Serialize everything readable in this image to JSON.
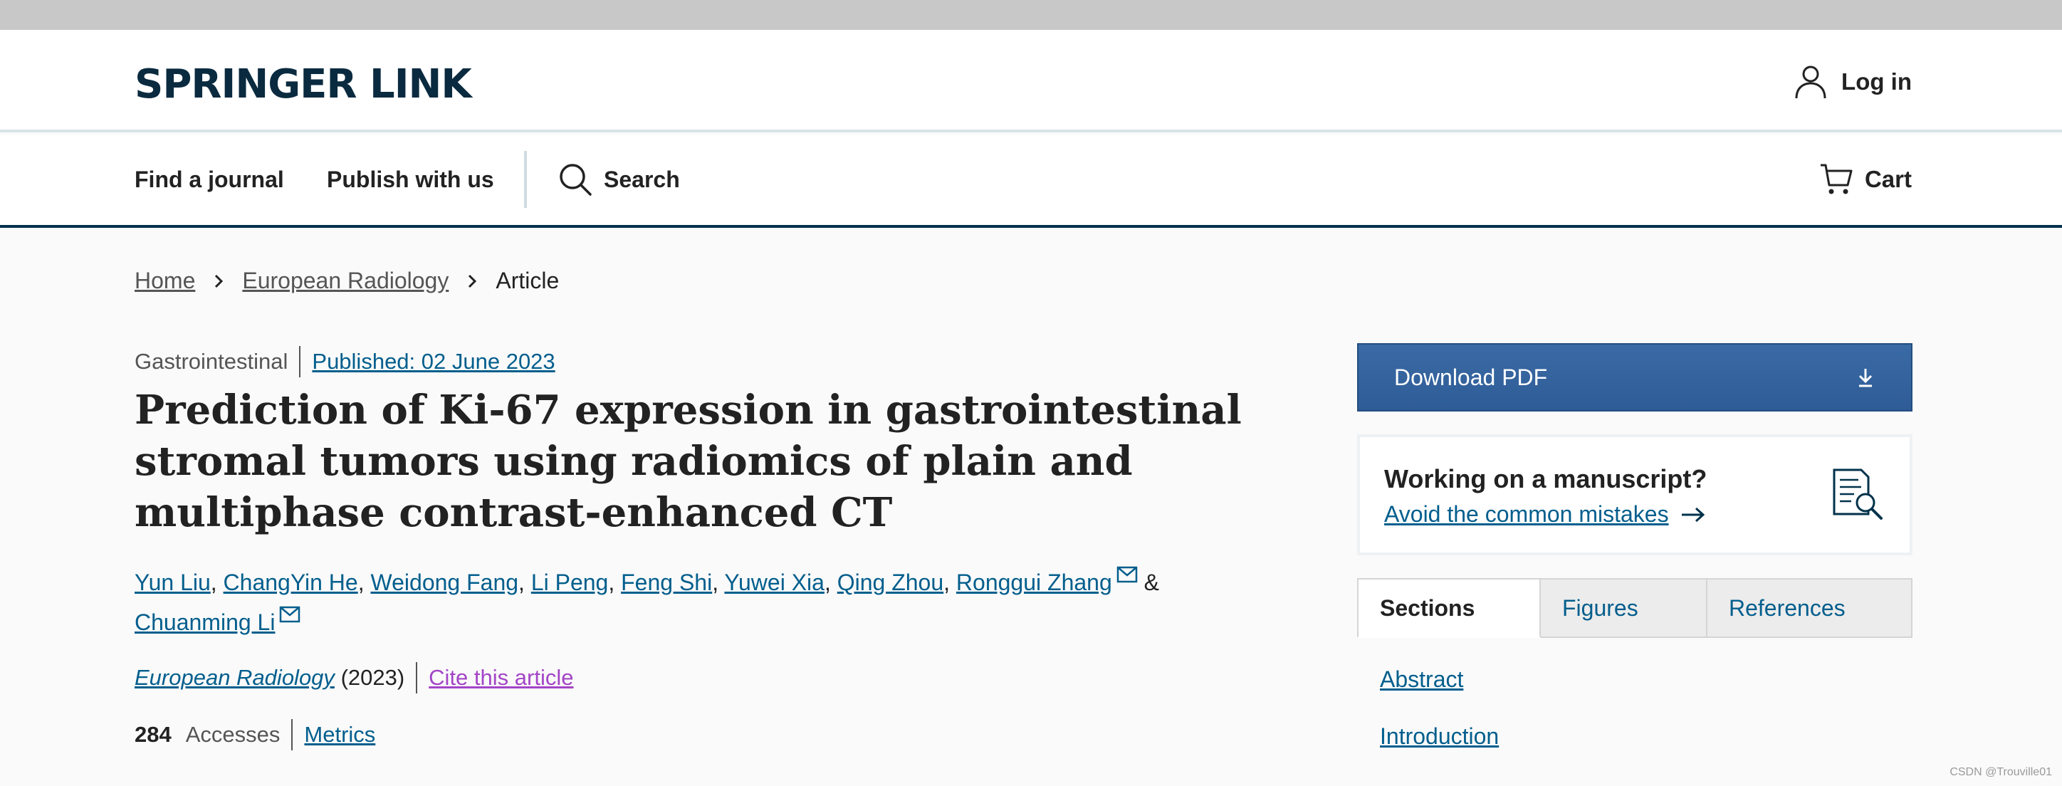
{
  "header": {
    "logo": "SPRINGER LINK",
    "login_label": "Log in"
  },
  "nav": {
    "find_journal": "Find a journal",
    "publish": "Publish with us",
    "search": "Search",
    "cart": "Cart"
  },
  "breadcrumb": {
    "items": [
      "Home",
      "European Radiology",
      "Article"
    ]
  },
  "article": {
    "category": "Gastrointestinal",
    "published": "Published: 02 June 2023",
    "title": "Prediction of Ki-67 expression in gastrointestinal stromal tumors using radiomics of plain and multiphase contrast-enhanced CT",
    "authors": [
      "Yun Liu",
      "ChangYin He",
      "Weidong Fang",
      "Li Peng",
      "Feng Shi",
      "Yuwei Xia",
      "Qing Zhou",
      "Ronggui Zhang",
      "Chuanming Li"
    ],
    "author_sep": ", ",
    "amp": "&",
    "journal": "European Radiology",
    "year": "(2023)",
    "cite": "Cite this article",
    "accesses_count": "284",
    "accesses_label": "Accesses",
    "metrics": "Metrics"
  },
  "sidebar": {
    "download": "Download PDF",
    "manuscript_title": "Working on a manuscript?",
    "manuscript_link": "Avoid the common mistakes",
    "tabs": [
      "Sections",
      "Figures",
      "References"
    ],
    "sections": [
      "Abstract",
      "Introduction"
    ]
  },
  "watermark": "CSDN @Trouville01",
  "colors": {
    "brand_navy": "#01324b",
    "link_blue": "#025e8d",
    "cite_purple": "#a345c6",
    "download_blue": "#3a6aa5"
  }
}
